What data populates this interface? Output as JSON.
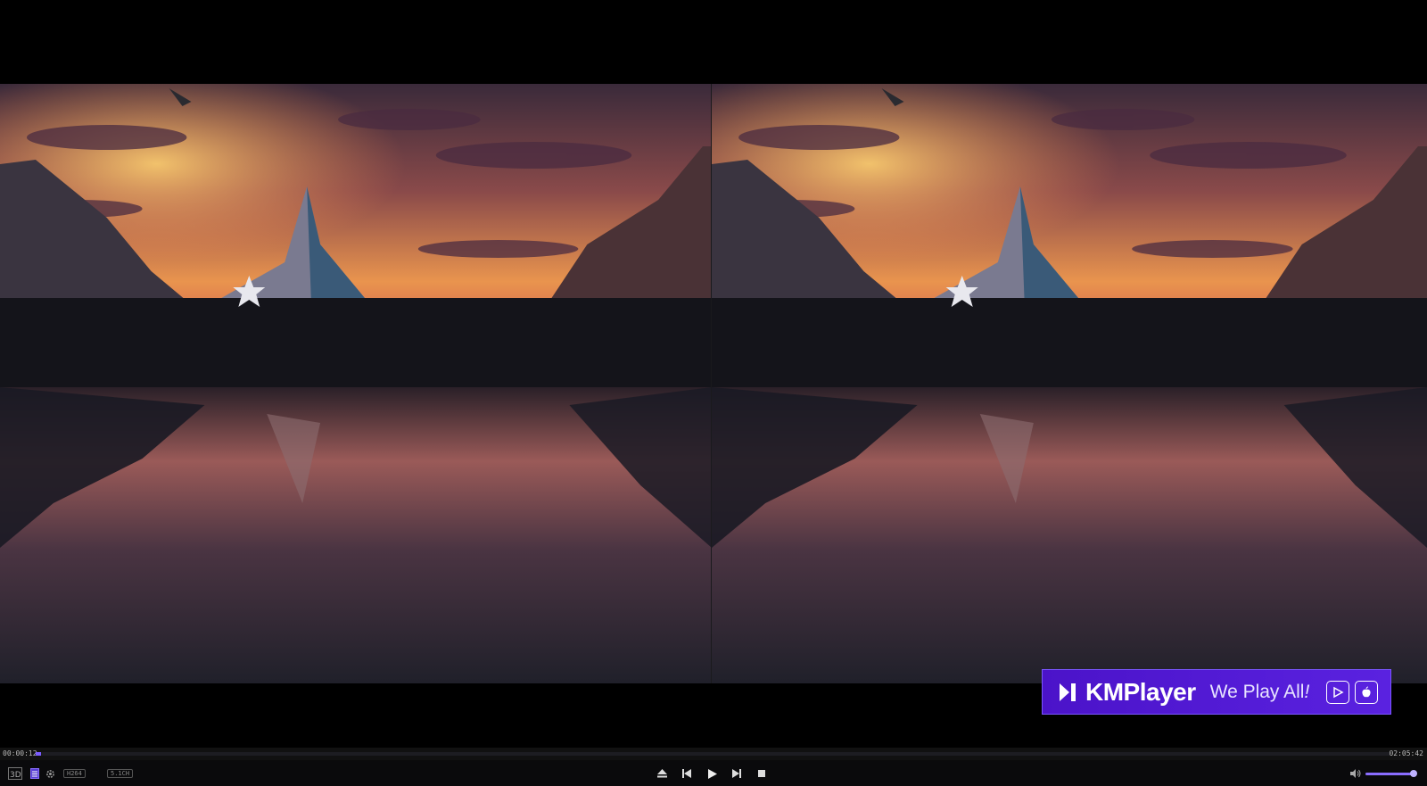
{
  "player": {
    "current_time": "00:00:12",
    "total_time": "02:05:42",
    "progress": 0.0016,
    "volume": 1.0
  },
  "toolbar_left": {
    "mode_3d_icon": "3d-icon",
    "playlist_icon": "playlist-icon",
    "settings_icon": "gear-icon",
    "codec_tag": "H264",
    "audio_tag": "5.1CH"
  },
  "toolbar_center": {
    "icons": [
      "eject-icon",
      "previous-icon",
      "play-icon",
      "next-icon",
      "stop-icon"
    ]
  },
  "ad": {
    "brand": "KMPlayer",
    "tagline": "We Play All",
    "tagline_suffix": "!"
  },
  "colors": {
    "accent": "#7b5cff",
    "ad_bg": "#4b13c9",
    "bar_bg": "#0a0a0c"
  }
}
